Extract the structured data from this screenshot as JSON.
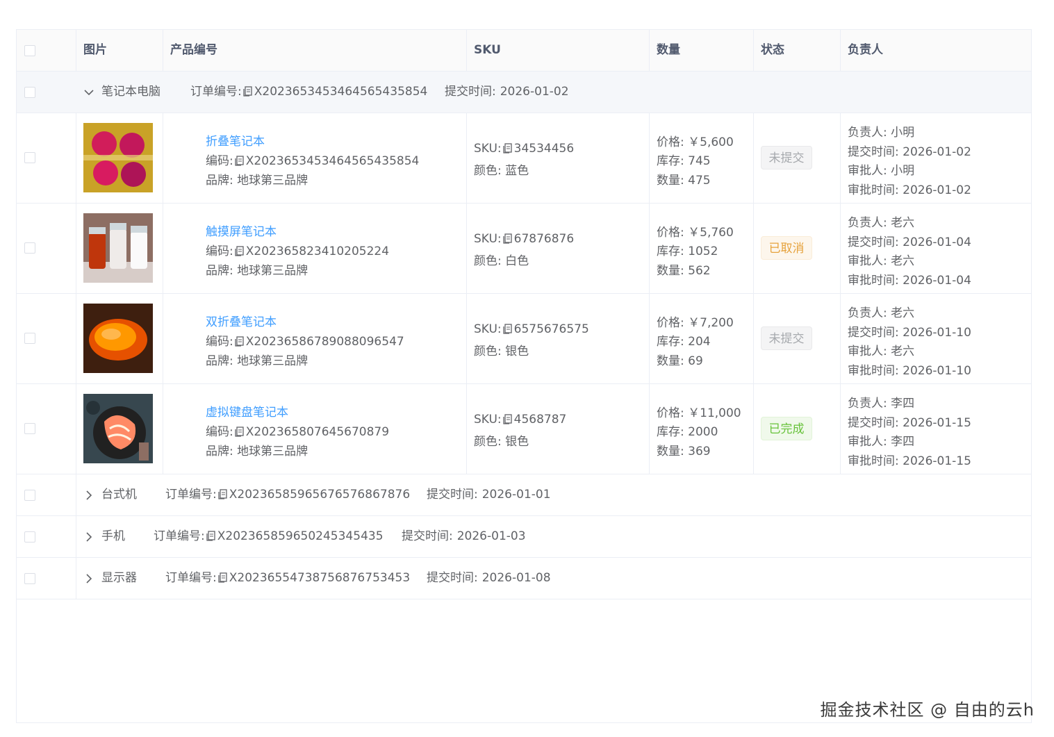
{
  "table": {
    "columns": [
      "图片",
      "产品编号",
      "SKU",
      "数量",
      "状态",
      "负责人"
    ],
    "copy_icon": "copy-icon",
    "expanded_icon": "chevron-down-icon",
    "collapsed_icon": "chevron-right-icon",
    "groups": [
      {
        "category": "笔记本电脑",
        "order_label": "订单编号:",
        "order_no": "X2023653453464565435854",
        "time_label": "提交时间:",
        "time": "2026-01-02",
        "expanded": true
      },
      {
        "category": "台式机",
        "order_label": "订单编号:",
        "order_no": "X2023658596567657686787​6",
        "time_label": "提交时间:",
        "time": "2026-01-01",
        "expanded": false
      },
      {
        "category": "手机",
        "order_label": "订单编号:",
        "order_no": "X202365859650245345435",
        "time_label": "提交时间:",
        "time": "2026-01-03",
        "expanded": false
      },
      {
        "category": "显示器",
        "order_label": "订单编号:",
        "order_no": "X2023655473875687675345​3",
        "time_label": "提交时间:",
        "time": "2026-01-08",
        "expanded": false
      }
    ],
    "products": [
      {
        "name": "折叠笔记本",
        "code_label": "编码:",
        "code": "X2023653453464565435854",
        "brand_label": "品牌:",
        "brand": "地球第三品牌",
        "sku_label": "SKU:",
        "sku": "34534456",
        "color_label": "颜色:",
        "color": "蓝色",
        "price_label": "价格:",
        "price": "￥5,600",
        "stock_label": "库存:",
        "stock": "745",
        "qty_label": "数量:",
        "qty": "475",
        "status": "未提交",
        "status_color": "#a6a9ad",
        "owner_label": "负责人:",
        "owner": "小明",
        "submit_label": "提交时间:",
        "submit_time": "2026-01-02",
        "approver_label": "审批人:",
        "approver": "小明",
        "approve_label": "审批时间:",
        "approve_time": "2026-01-02"
      },
      {
        "name": "触摸屏笔记本",
        "code_label": "编码:",
        "code": "X202365823410205224",
        "brand_label": "品牌:",
        "brand": "地球第三品牌",
        "sku_label": "SKU:",
        "sku": "67876876",
        "color_label": "颜色:",
        "color": "白色",
        "price_label": "价格:",
        "price": "￥5,760",
        "stock_label": "库存:",
        "stock": "1052",
        "qty_label": "数量:",
        "qty": "562",
        "status": "已取消",
        "status_color": "#e6a23c",
        "owner_label": "负责人:",
        "owner": "老六",
        "submit_label": "提交时间:",
        "submit_time": "2026-01-04",
        "approver_label": "审批人:",
        "approver": "老六",
        "approve_label": "审批时间:",
        "approve_time": "2026-01-04"
      },
      {
        "name": "双折叠笔记本",
        "code_label": "编码:",
        "code": "X2023658678908809654​7",
        "brand_label": "品牌:",
        "brand": "地球第三品牌",
        "sku_label": "SKU:",
        "sku": "6575676575",
        "color_label": "颜色:",
        "color": "银色",
        "price_label": "价格:",
        "price": "￥7,200",
        "stock_label": "库存:",
        "stock": "204",
        "qty_label": "数量:",
        "qty": "69",
        "status": "未提交",
        "status_color": "#a6a9ad",
        "owner_label": "负责人:",
        "owner": "老六",
        "submit_label": "提交时间:",
        "submit_time": "2026-01-10",
        "approver_label": "审批人:",
        "approver": "老六",
        "approve_label": "审批时间:",
        "approve_time": "2026-01-10"
      },
      {
        "name": "虚拟键盘笔记本",
        "code_label": "编码:",
        "code": "X202365807645670879",
        "brand_label": "品牌:",
        "brand": "地球第三品牌",
        "sku_label": "SKU:",
        "sku": "4568787",
        "color_label": "颜色:",
        "color": "银色",
        "price_label": "价格:",
        "price": "￥11,000",
        "stock_label": "库存:",
        "stock": "2000",
        "qty_label": "数量:",
        "qty": "369",
        "status": "已完成",
        "status_color": "#67c23a",
        "owner_label": "负责人:",
        "owner": "李四",
        "submit_label": "提交时间:",
        "submit_time": "2026-01-15",
        "approver_label": "审批人:",
        "approver": "李四",
        "approve_label": "审批时间:",
        "approve_time": "2026-01-15"
      }
    ]
  },
  "watermark": "掘金技术社区 @ 自由的云h"
}
